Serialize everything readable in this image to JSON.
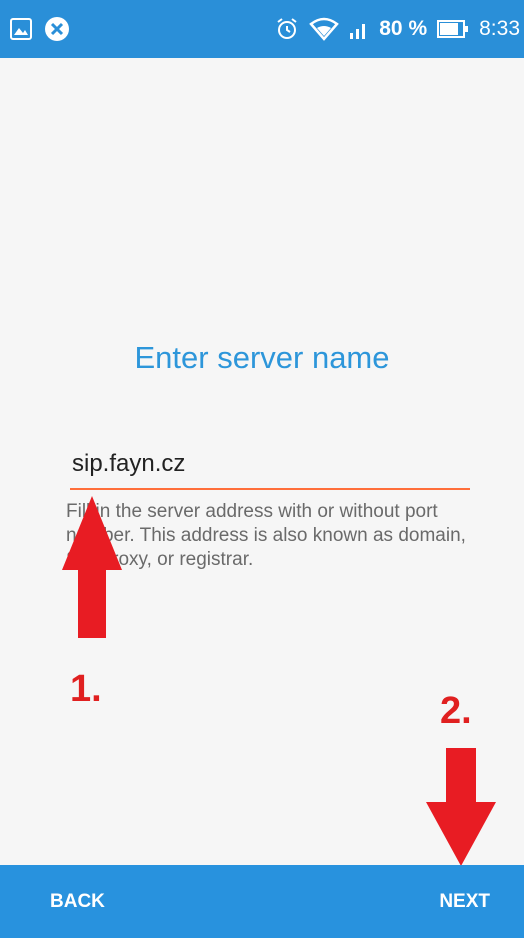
{
  "status_bar": {
    "left_icons": [
      "gallery-icon",
      "close-circle-icon"
    ],
    "right_icons": [
      "alarm-icon",
      "wifi-icon",
      "signal-icon",
      "battery-icon"
    ],
    "battery_percent": "80 %",
    "time": "8:33",
    "color": "#2a8fd8"
  },
  "main": {
    "title": "Enter server name",
    "server_field": {
      "value": "sip.fayn.cz",
      "underline_color": "#ff6e3a"
    },
    "hint": "Fill in the server address with or without port number. This address is also known as domain, SIP proxy, or registrar."
  },
  "annotations": {
    "label_1": "1.",
    "label_2": "2.",
    "color": "#e02020"
  },
  "footer": {
    "back_label": "BACK",
    "next_label": "NEXT",
    "color": "#2892de"
  }
}
